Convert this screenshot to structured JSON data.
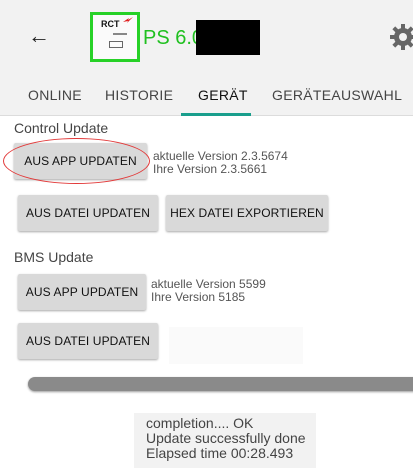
{
  "appbar": {
    "back_icon": "arrow-left-icon",
    "logo_text": "RCT",
    "title": "PS 6.0",
    "settings_icon": "gear-icon",
    "colors": {
      "title": "#20c020",
      "logo_border": "#27d127",
      "accent": "#199e8c"
    }
  },
  "tabs": [
    {
      "label": "ONLINE"
    },
    {
      "label": "HISTORIE"
    },
    {
      "label": "GERÄT"
    },
    {
      "label": "GERÄTEAUSWAHL"
    }
  ],
  "active_tab": "GERÄT",
  "control_update": {
    "title": "Control Update",
    "app_button": "AUS APP UPDATEN",
    "current_version": "aktuelle Version 2.3.5674",
    "your_version": "Ihre Version 2.3.5661",
    "file_button": "AUS DATEI UPDATEN",
    "hex_button": "HEX DATEI EXPORTIEREN"
  },
  "bms_update": {
    "title": "BMS Update",
    "app_button": "AUS APP UPDATEN",
    "current_version": "aktuelle Version 5599",
    "your_version": "Ihre Version 5185",
    "file_button": "AUS DATEI UPDATEN"
  },
  "progress": {
    "value": 1.0
  },
  "log": [
    "completion.... OK",
    "Update successfully done",
    "Elapsed time 00:28.493"
  ]
}
